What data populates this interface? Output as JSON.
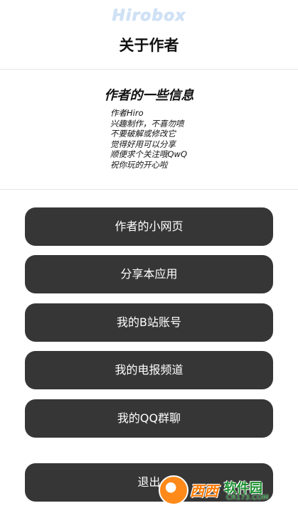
{
  "header": {
    "logo_text": "Hirobox",
    "title": "关于作者"
  },
  "info": {
    "title": "作者的一些信息",
    "lines": [
      "作者Hiro",
      "兴趣制作，不喜勿喷",
      "不要破解或修改它",
      "觉得好用可以分享",
      "顺便求个关注哦QwQ",
      "祝你玩的开心啦"
    ]
  },
  "buttons": [
    {
      "label": "作者的小网页"
    },
    {
      "label": "分享本应用"
    },
    {
      "label": "我的B站账号"
    },
    {
      "label": "我的电报频道"
    },
    {
      "label": "我的QQ群聊"
    },
    {
      "label": "退出"
    }
  ],
  "watermark": {
    "brand": "西西",
    "sub": "软件园",
    "domain": "CR173.COM"
  },
  "colors": {
    "button_bg": "#363636",
    "button_text": "#ffffff",
    "logo": "#cfe1f5"
  }
}
